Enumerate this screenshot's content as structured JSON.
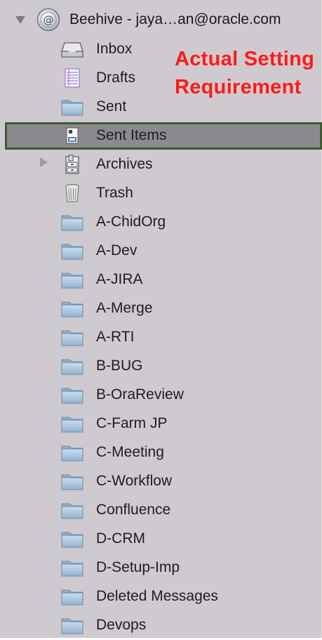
{
  "account": {
    "label": "Beehive - jaya…an@oracle.com",
    "expanded": true
  },
  "annotation": {
    "line1": "Actual Setting",
    "line2": "Requirement",
    "color": "#ff1a1a"
  },
  "folders": [
    {
      "label": "Inbox",
      "icon": "inbox-tray-icon"
    },
    {
      "label": "Drafts",
      "icon": "drafts-icon"
    },
    {
      "label": "Sent",
      "icon": "folder-icon"
    },
    {
      "label": "Sent Items",
      "icon": "sent-items-icon",
      "selected": true
    },
    {
      "label": "Archives",
      "icon": "archive-box-icon",
      "collapsed": true
    },
    {
      "label": "Trash",
      "icon": "trash-can-icon"
    },
    {
      "label": "A-ChidOrg",
      "icon": "folder-icon"
    },
    {
      "label": "A-Dev",
      "icon": "folder-icon"
    },
    {
      "label": "A-JIRA",
      "icon": "folder-icon"
    },
    {
      "label": "A-Merge",
      "icon": "folder-icon"
    },
    {
      "label": "A-RTI",
      "icon": "folder-icon"
    },
    {
      "label": "B-BUG",
      "icon": "folder-icon"
    },
    {
      "label": "B-OraReview",
      "icon": "folder-icon"
    },
    {
      "label": "C-Farm JP",
      "icon": "folder-icon"
    },
    {
      "label": "C-Meeting",
      "icon": "folder-icon"
    },
    {
      "label": "C-Workflow",
      "icon": "folder-icon"
    },
    {
      "label": "Confluence",
      "icon": "folder-icon"
    },
    {
      "label": "D-CRM",
      "icon": "folder-icon"
    },
    {
      "label": "D-Setup-Imp",
      "icon": "folder-icon"
    },
    {
      "label": "Deleted Messages",
      "icon": "folder-icon"
    },
    {
      "label": "Devops",
      "icon": "folder-icon"
    }
  ],
  "colors": {
    "sidebar_background": "#cfcacf",
    "selection_fill": "#8d8a8f",
    "selection_border": "#3d5a2f",
    "folder_blue": "#a9c3dc"
  }
}
